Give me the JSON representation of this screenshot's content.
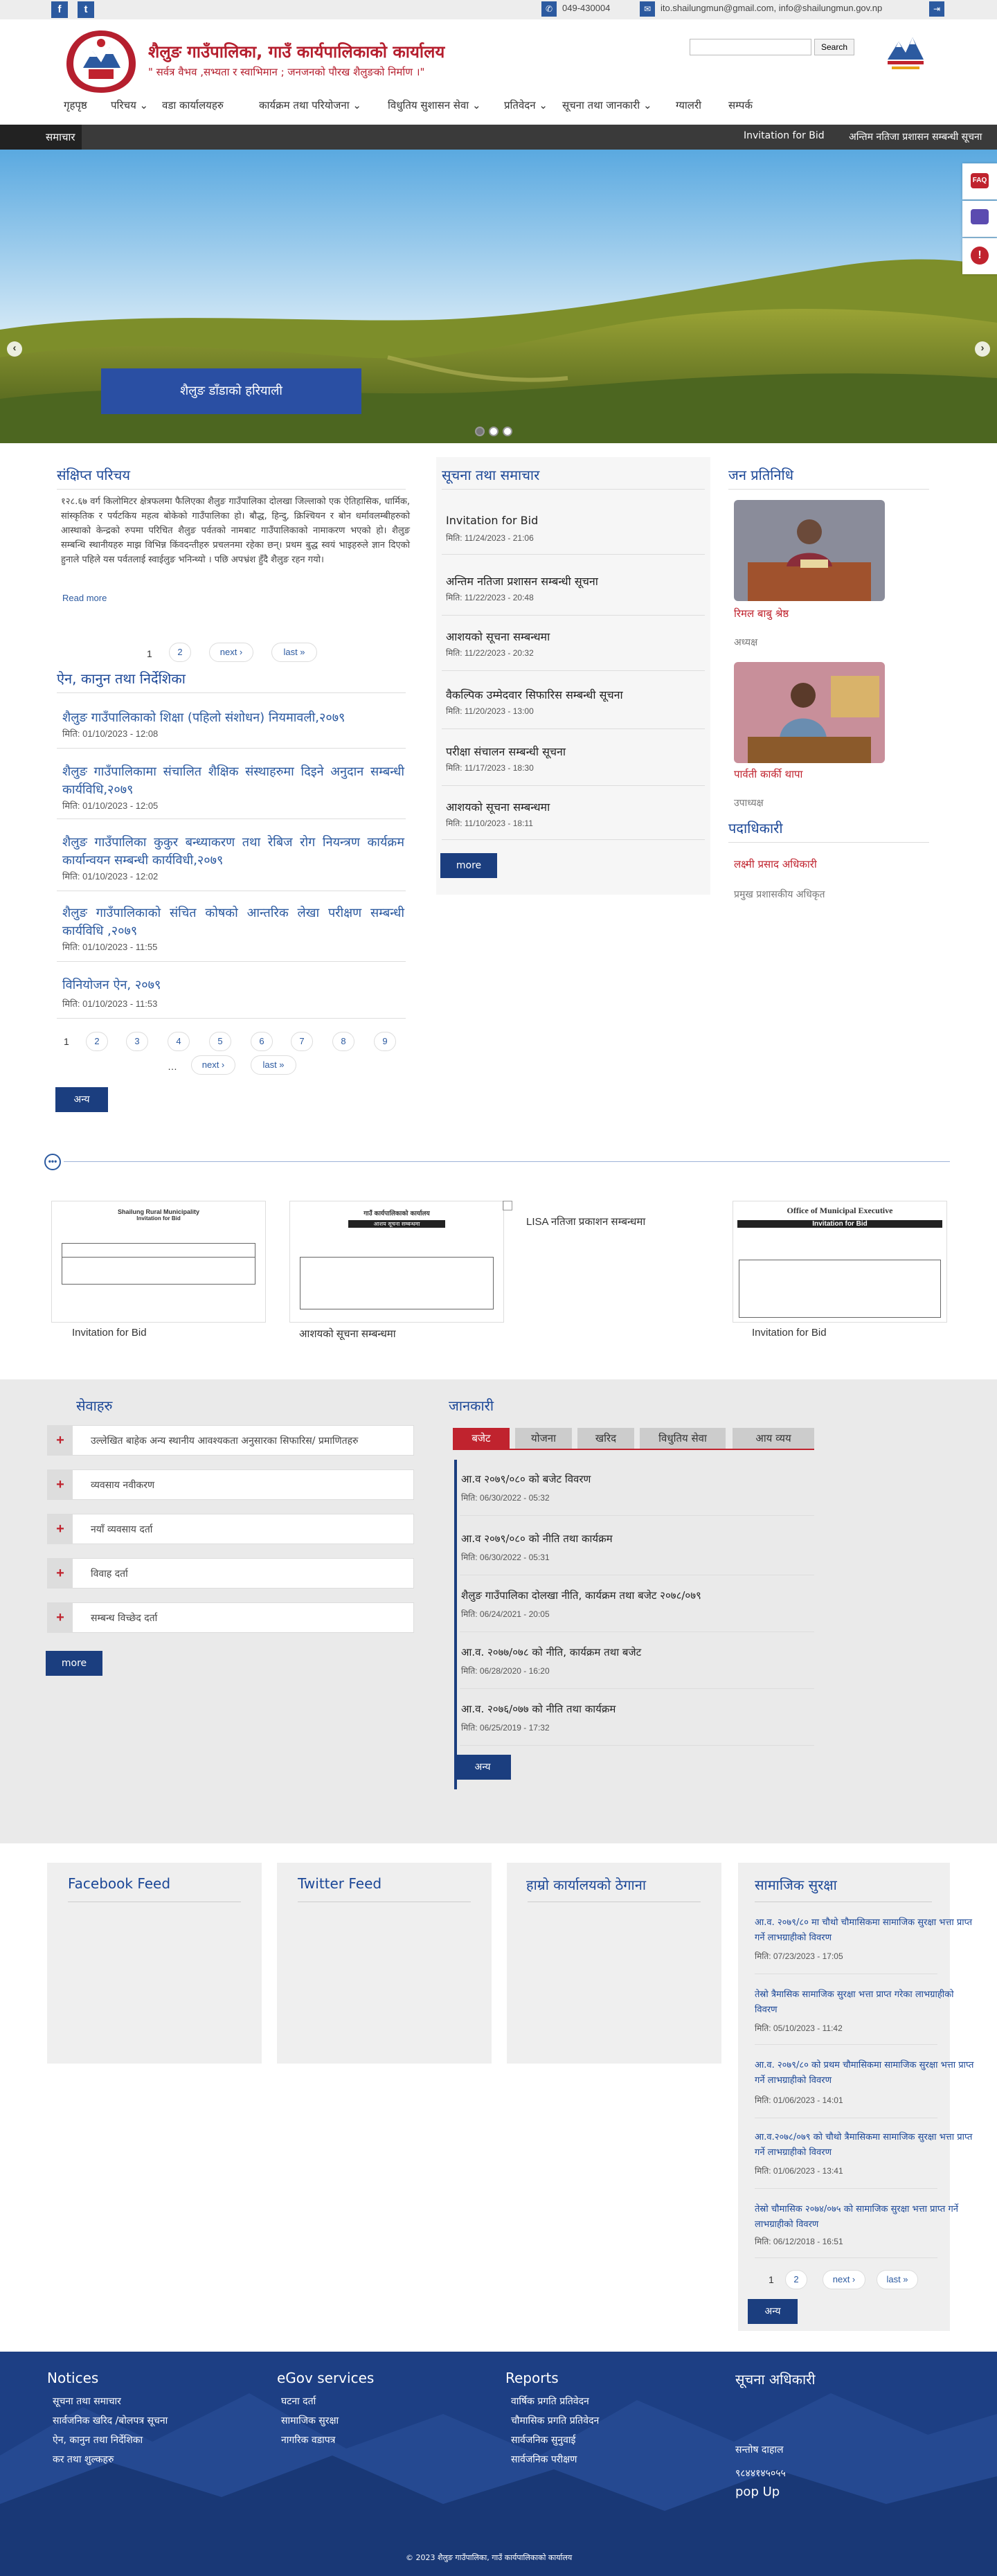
{
  "topbar": {
    "phone": "049-430004",
    "email": "ito.shailungmun@gmail.com, info@shailungmun.gov.np"
  },
  "header": {
    "title": "शैलुङ गाउँपालिका, गाउँ कार्यपालिकाको कार्यालय",
    "slogan": "\" सर्वत्र वैभव ,सभ्यता र स्वाभिमान ; जनजनको पौरख शैलुङको निर्माण ।\"",
    "search_placeholder": "",
    "search_button": "Search"
  },
  "nav": [
    "गृहपृष्ठ",
    "परिचय",
    "वडा कार्यालयहरु",
    "कार्यक्रम तथा परियोजना",
    "विधुतिय सुशासन सेवा",
    "प्रतिवेदन",
    "सूचना तथा जानकारी",
    "ग्यालरी",
    "सम्पर्क"
  ],
  "ticker": {
    "label": "समाचार",
    "items": [
      "Invitation for Bid",
      "अन्तिम नतिजा प्रशासन सम्बन्धी सूचना"
    ]
  },
  "hero": {
    "caption": "शैलुङ डाँडाको हरियाली"
  },
  "intro": {
    "title": "संक्षिप्त परिचय",
    "text": "१२८.६७ वर्ग किलोमिटर क्षेत्रफलमा फैलिएका शैलुङ गाउँपालिका दोलखा जिल्लाको एक ऐतिहासिक, धार्मिक, सांस्कृतिक र पर्यटकिय महत्व बोकेको गाउँपालिका हो। बौद्ध, हिन्दु, क्रिश्चियन र बोन धर्मावलम्बीहरुको आस्थाको केन्द्रको रुपमा परिचित शैलुङ पर्वतको नामबाट गाउँपालिकाको नामाकरण भएको हो। शैलुङ सम्बन्धि स्थानीयहरु माझ विभिन्न किंवदन्तीहरु प्रचलनमा रहेका छन्। प्रथम बुद्ध स्वयं भाइहरुले ज्ञान दिएको हुनाले पहिले यस पर्वतलाई स्वाईलुङ भनिन्थ्यो । पछि अपभ्रंश हुँदै शैलुङ रहन गयो।",
    "read_more": "Read more"
  },
  "intro_pager": {
    "pages": [
      "1",
      "2"
    ],
    "next": "next ›",
    "last": "last »"
  },
  "acts": {
    "title": "ऐन, कानुन तथा निर्देशिका",
    "items": [
      {
        "title": "शैलुङ गाउँपालिकाको शिक्षा (पहिलो संशोधन) नियमावली,२०७९",
        "date": "मिति: 01/10/2023 - 12:08"
      },
      {
        "title": "शैलुङ गाउँपालिकामा संचालित शैक्षिक संस्थाहरुमा दिइने अनुदान सम्बन्धी कार्यविधि,२०७९",
        "date": "मिति: 01/10/2023 - 12:05"
      },
      {
        "title": "शैलुङ गाउँपालिका कुकुर बन्ध्याकरण तथा रेबिज रोग नियन्त्रण कार्यक्रम कार्यान्वयन सम्बन्धी कार्यविधी,२०७९",
        "date": "मिति: 01/10/2023 - 12:02"
      },
      {
        "title": "शैलुङ गाउँपालिकाको संचित कोषको आन्तरिक लेखा परीक्षण सम्बन्धी कार्यविधि ,२०७९",
        "date": "मिति: 01/10/2023 - 11:55"
      },
      {
        "title": "विनियोजन ऐन, २०७९",
        "date": "मिति: 01/10/2023 - 11:53"
      }
    ],
    "pages": [
      "1",
      "2",
      "3",
      "4",
      "5",
      "6",
      "7",
      "8",
      "9"
    ],
    "ellipsis": "…",
    "next": "next ›",
    "last": "last »",
    "more": "अन्य"
  },
  "news": {
    "title": "सूचना तथा समाचार",
    "items": [
      {
        "title": "Invitation for Bid",
        "date": "मिति: 11/24/2023 - 21:06"
      },
      {
        "title": "अन्तिम नतिजा प्रशासन सम्बन्धी सूचना",
        "date": "मिति: 11/22/2023 - 20:48"
      },
      {
        "title": "आशयको सूचना सम्बन्धमा",
        "date": "मिति: 11/22/2023 - 20:32"
      },
      {
        "title": "वैकल्पिक उम्मेदवार सिफारिस सम्बन्धी सूचना",
        "date": "मिति: 11/20/2023 - 13:00"
      },
      {
        "title": "परीक्षा संचालन सम्बन्धी सूचना",
        "date": "मिति: 11/17/2023 - 18:30"
      },
      {
        "title": "आशयको सूचना सम्बन्धमा",
        "date": "मिति: 11/10/2023 - 18:11"
      }
    ],
    "more": "more"
  },
  "reps": {
    "title": "जन प्रतिनिधि",
    "items": [
      {
        "name": "रिमल बाबु श्रेष्ठ",
        "role": "अध्यक्ष"
      },
      {
        "name": "पार्वती कार्की थापा",
        "role": "उपाध्यक्ष"
      }
    ]
  },
  "officials": {
    "title": "पदाधिकारी",
    "items": [
      {
        "name": "लक्ष्मी प्रसाद अधिकारी",
        "role": "प्रमुख प्रशासकीय अधिकृत"
      }
    ]
  },
  "gallery": {
    "items": [
      {
        "caption": "Invitation for Bid",
        "doc_title": "Shailung Rural Municipality",
        "doc_sub": "Invitation for Bid"
      },
      {
        "caption": "आशयको सूचना सम्बन्धमा",
        "doc_title": "गाउँ कार्यपालिकाको कार्यालय",
        "doc_sub": "आशय सूचना सम्बन्धमा"
      },
      {
        "caption": "LISA नतिजा प्रकाशन सम्बन्धमा",
        "doc_title": "",
        "doc_sub": ""
      },
      {
        "caption": "Invitation for Bid",
        "doc_title": "Office of Municipal Executive",
        "doc_sub": "Invitation for Bid"
      }
    ]
  },
  "services": {
    "title": "सेवाहरु",
    "items": [
      "उल्लेखित बाहेक अन्य स्थानीय आवश्यकता अनुसारका सिफारिस/ प्रमाणितहरु",
      "व्यवसाय नवीकरण",
      "नयाँ व्यवसाय दर्ता",
      "विवाह दर्ता",
      "सम्बन्ध विच्छेद दर्ता"
    ],
    "more": "more"
  },
  "info": {
    "title": "जानकारी",
    "tabs": [
      "बजेट",
      "योजना",
      "खरिद",
      "विधुतिय सेवा",
      "आय व्यय"
    ],
    "items": [
      {
        "title": "आ.व २०७९/०८० को बजेट विवरण",
        "date": "मिति: 06/30/2022 - 05:32"
      },
      {
        "title": "आ.व २०७९/०८० को नीति तथा कार्यक्रम",
        "date": "मिति: 06/30/2022 - 05:31"
      },
      {
        "title": "शैलुङ गाउँपालिका दोलखा नीति, कार्यक्रम तथा बजेट २०७८/०७९",
        "date": "मिति: 06/24/2021 - 20:05"
      },
      {
        "title": "आ.व. २०७७/०७८ को नीति, कार्यक्रम तथा बजेट",
        "date": "मिति: 06/28/2020 - 16:20"
      },
      {
        "title": "आ.व. २०७६/०७७ को नीति तथा कार्यक्रम",
        "date": "मिति: 06/25/2019 - 17:32"
      }
    ],
    "more": "अन्य"
  },
  "feeds": {
    "facebook": "Facebook Feed",
    "twitter": "Twitter Feed",
    "address": "हाम्रो कार्यालयको ठेगाना"
  },
  "social_security": {
    "title": "सामाजिक सुरक्षा",
    "items": [
      {
        "title": "आ.व. २०७९/८० मा चौथो चौमासिकमा सामाजिक सुरक्षा भत्ता प्राप्त गर्ने लाभग्राहीको विवरण",
        "date": "मिति: 07/23/2023 - 17:05"
      },
      {
        "title": "तेस्रो त्रैमासिक सामाजिक सुरक्षा भत्ता प्राप्त गरेका लाभग्राहीको विवरण",
        "date": "मिति: 05/10/2023 - 11:42"
      },
      {
        "title": "आ.व. २०७९/८० को प्रथम चौमासिकमा सामाजिक सुरक्षा भत्ता प्राप्त गर्ने लाभग्राहीको विवरण",
        "date": "मिति: 01/06/2023 - 14:01"
      },
      {
        "title": "आ.व.२०७८/०७९ को चौथो त्रैमासिकमा सामाजिक सुरक्षा भत्ता प्राप्त गर्ने लाभग्राहीको विवरण",
        "date": "मिति: 01/06/2023 - 13:41"
      },
      {
        "title": "तेस्रो चौमासिक २०७४/०७५ को सामाजिक सुरक्षा भत्ता प्राप्त गर्ने लाभग्राहीको विवरण",
        "date": "मिति: 06/12/2018 - 16:51"
      }
    ],
    "pages": [
      "1",
      "2"
    ],
    "next": "next ›",
    "last": "last »",
    "more": "अन्य"
  },
  "footer": {
    "notices": {
      "title": "Notices",
      "links": [
        "सूचना तथा समाचार",
        "सार्वजनिक खरिद /बोलपत्र सूचना",
        "ऐन, कानुन तथा निर्देशिका",
        "कर तथा शुल्कहरु"
      ]
    },
    "egov": {
      "title": "eGov services",
      "links": [
        "घटना दर्ता",
        "सामाजिक सुरक्षा",
        "नागरिक वडापत्र"
      ]
    },
    "reports": {
      "title": "Reports",
      "links": [
        "वार्षिक प्रगति प्रतिवेदन",
        "चौमासिक प्रगति प्रतिवेदन",
        "सार्वजनिक सुनुवाई",
        "सार्वजनिक परीक्षण"
      ]
    },
    "info_officer": {
      "title": "सूचना अधिकारी",
      "name": "सन्तोष दाहाल",
      "phone": "९८४४१४५०५५",
      "popup": "pop Up"
    },
    "copyright": "© 2023 शैलुङ गाउँपालिका, गाउँ कार्यपालिकाको कार्यालय"
  },
  "colors": {
    "brand_red": "#b51f2e",
    "brand_blue": "#1b4797",
    "button_blue": "#1b3e7f",
    "footer_bg": "#1d3f84"
  }
}
